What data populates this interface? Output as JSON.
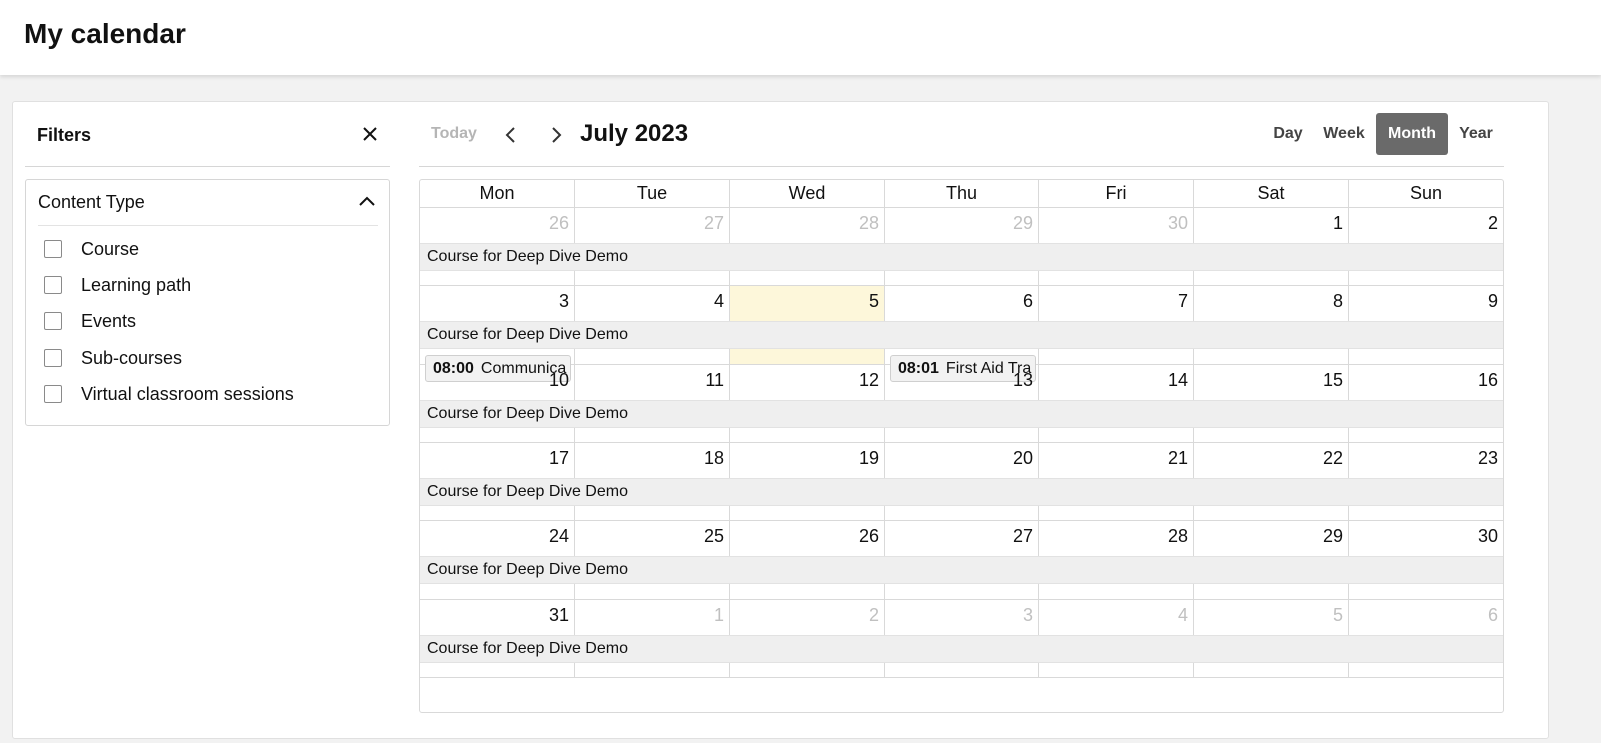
{
  "page": {
    "title": "My calendar"
  },
  "filters": {
    "title": "Filters",
    "close_icon": "close-icon",
    "content_type": {
      "title": "Content Type",
      "chevron_icon": "chevron-up-icon",
      "options": [
        {
          "label": "Course",
          "checked": false
        },
        {
          "label": "Learning path",
          "checked": false
        },
        {
          "label": "Events",
          "checked": false
        },
        {
          "label": "Sub-courses",
          "checked": false
        },
        {
          "label": "Virtual classroom sessions",
          "checked": false
        }
      ]
    }
  },
  "toolbar": {
    "today_label": "Today",
    "prev_icon": "chevron-left-icon",
    "next_icon": "chevron-right-icon",
    "month_title": "July 2023",
    "views": [
      "Day",
      "Week",
      "Month",
      "Year"
    ],
    "active_view": "Month"
  },
  "calendar": {
    "weekdays": [
      "Mon",
      "Tue",
      "Wed",
      "Thu",
      "Fri",
      "Sat",
      "Sun"
    ],
    "today": {
      "week": 1,
      "day": 2
    },
    "weeks": [
      {
        "days": [
          {
            "num": "26",
            "other": true
          },
          {
            "num": "27",
            "other": true
          },
          {
            "num": "28",
            "other": true
          },
          {
            "num": "29",
            "other": true
          },
          {
            "num": "30",
            "other": true
          },
          {
            "num": "1",
            "other": false
          },
          {
            "num": "2",
            "other": false
          }
        ],
        "allday": "Course for Deep Dive Demo",
        "events": []
      },
      {
        "days": [
          {
            "num": "3",
            "other": false
          },
          {
            "num": "4",
            "other": false
          },
          {
            "num": "5",
            "other": false
          },
          {
            "num": "6",
            "other": false
          },
          {
            "num": "7",
            "other": false
          },
          {
            "num": "8",
            "other": false
          },
          {
            "num": "9",
            "other": false
          }
        ],
        "allday": "Course for Deep Dive Demo",
        "events": [
          {
            "day": 0,
            "time": "08:00",
            "title": "Communica"
          },
          {
            "day": 3,
            "time": "08:01",
            "title": "First Aid Tra"
          }
        ]
      },
      {
        "days": [
          {
            "num": "10",
            "other": false
          },
          {
            "num": "11",
            "other": false
          },
          {
            "num": "12",
            "other": false
          },
          {
            "num": "13",
            "other": false
          },
          {
            "num": "14",
            "other": false
          },
          {
            "num": "15",
            "other": false
          },
          {
            "num": "16",
            "other": false
          }
        ],
        "allday": "Course for Deep Dive Demo",
        "events": []
      },
      {
        "days": [
          {
            "num": "17",
            "other": false
          },
          {
            "num": "18",
            "other": false
          },
          {
            "num": "19",
            "other": false
          },
          {
            "num": "20",
            "other": false
          },
          {
            "num": "21",
            "other": false
          },
          {
            "num": "22",
            "other": false
          },
          {
            "num": "23",
            "other": false
          }
        ],
        "allday": "Course for Deep Dive Demo",
        "events": []
      },
      {
        "days": [
          {
            "num": "24",
            "other": false
          },
          {
            "num": "25",
            "other": false
          },
          {
            "num": "26",
            "other": false
          },
          {
            "num": "27",
            "other": false
          },
          {
            "num": "28",
            "other": false
          },
          {
            "num": "29",
            "other": false
          },
          {
            "num": "30",
            "other": false
          }
        ],
        "allday": "Course for Deep Dive Demo",
        "events": []
      },
      {
        "days": [
          {
            "num": "31",
            "other": false
          },
          {
            "num": "1",
            "other": true
          },
          {
            "num": "2",
            "other": true
          },
          {
            "num": "3",
            "other": true
          },
          {
            "num": "4",
            "other": true
          },
          {
            "num": "5",
            "other": true
          },
          {
            "num": "6",
            "other": true
          }
        ],
        "allday": "Course for Deep Dive Demo",
        "events": []
      }
    ]
  }
}
